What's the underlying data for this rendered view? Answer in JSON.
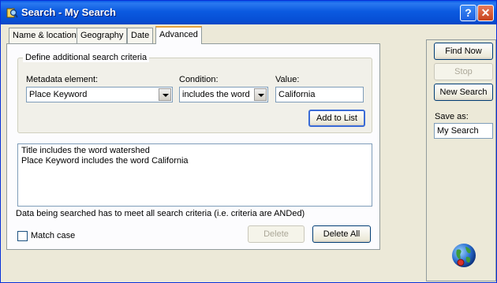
{
  "window": {
    "title": "Search - My Search",
    "help_label": "?",
    "close_label": "✕",
    "app_icon": "search-app-icon"
  },
  "tabs": [
    "Name & location",
    "Geography",
    "Date",
    "Advanced"
  ],
  "active_tab": "Advanced",
  "criteria": {
    "group_title": "Define additional search criteria",
    "metadata_label": "Metadata element:",
    "metadata_value": "Place Keyword",
    "condition_label": "Condition:",
    "condition_value": "includes the word",
    "value_label": "Value:",
    "value_value": "California",
    "add_button": "Add to List"
  },
  "list_items": [
    "Title includes the word watershed",
    "Place Keyword includes the word California"
  ],
  "note": "Data being searched has to meet all search criteria (i.e. criteria are ANDed)",
  "match_case_label": "Match case",
  "match_case_checked": false,
  "delete_button": "Delete",
  "delete_all_button": "Delete All",
  "side": {
    "find_now": "Find Now",
    "stop": "Stop",
    "new_search": "New Search",
    "save_as_label": "Save as:",
    "save_as_value": "My Search"
  },
  "colors": {
    "titlebar": "#0a5ae8",
    "window_bg": "#ece9d8",
    "active_tab_accent": "#e6a23c"
  }
}
